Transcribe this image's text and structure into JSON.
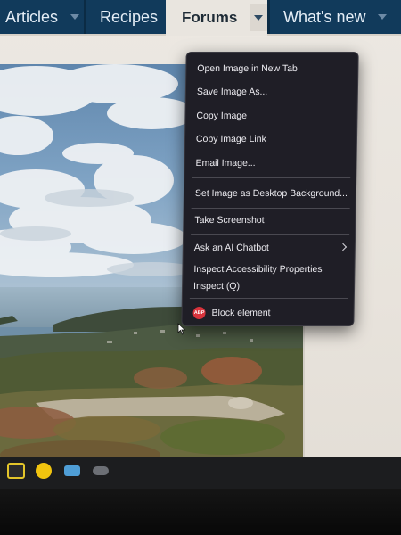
{
  "nav": {
    "items": [
      {
        "label": "Articles"
      },
      {
        "label": "Recipes"
      },
      {
        "label": "Forums"
      },
      {
        "label": "What's new"
      }
    ]
  },
  "context_menu": {
    "items": [
      {
        "label": "Open Image in New Tab"
      },
      {
        "label": "Save Image As..."
      },
      {
        "label": "Copy Image"
      },
      {
        "label": "Copy Image Link"
      },
      {
        "label": "Email Image..."
      },
      {
        "label": "Set Image as Desktop Background..."
      },
      {
        "label": "Take Screenshot"
      },
      {
        "label": "Ask an AI Chatbot"
      },
      {
        "label": "Inspect Accessibility Properties"
      },
      {
        "label": "Inspect (Q)"
      },
      {
        "label": "Block element",
        "badge": "ABP"
      }
    ]
  },
  "taskbar": {
    "icons": [
      "sticky-notes-icon",
      "norton-check-icon",
      "file-explorer-icon",
      "misc-app-icon"
    ]
  },
  "colors": {
    "nav_bg": "#113a5b",
    "menu_bg": "#1f1e26",
    "abp_red": "#d8333c"
  }
}
